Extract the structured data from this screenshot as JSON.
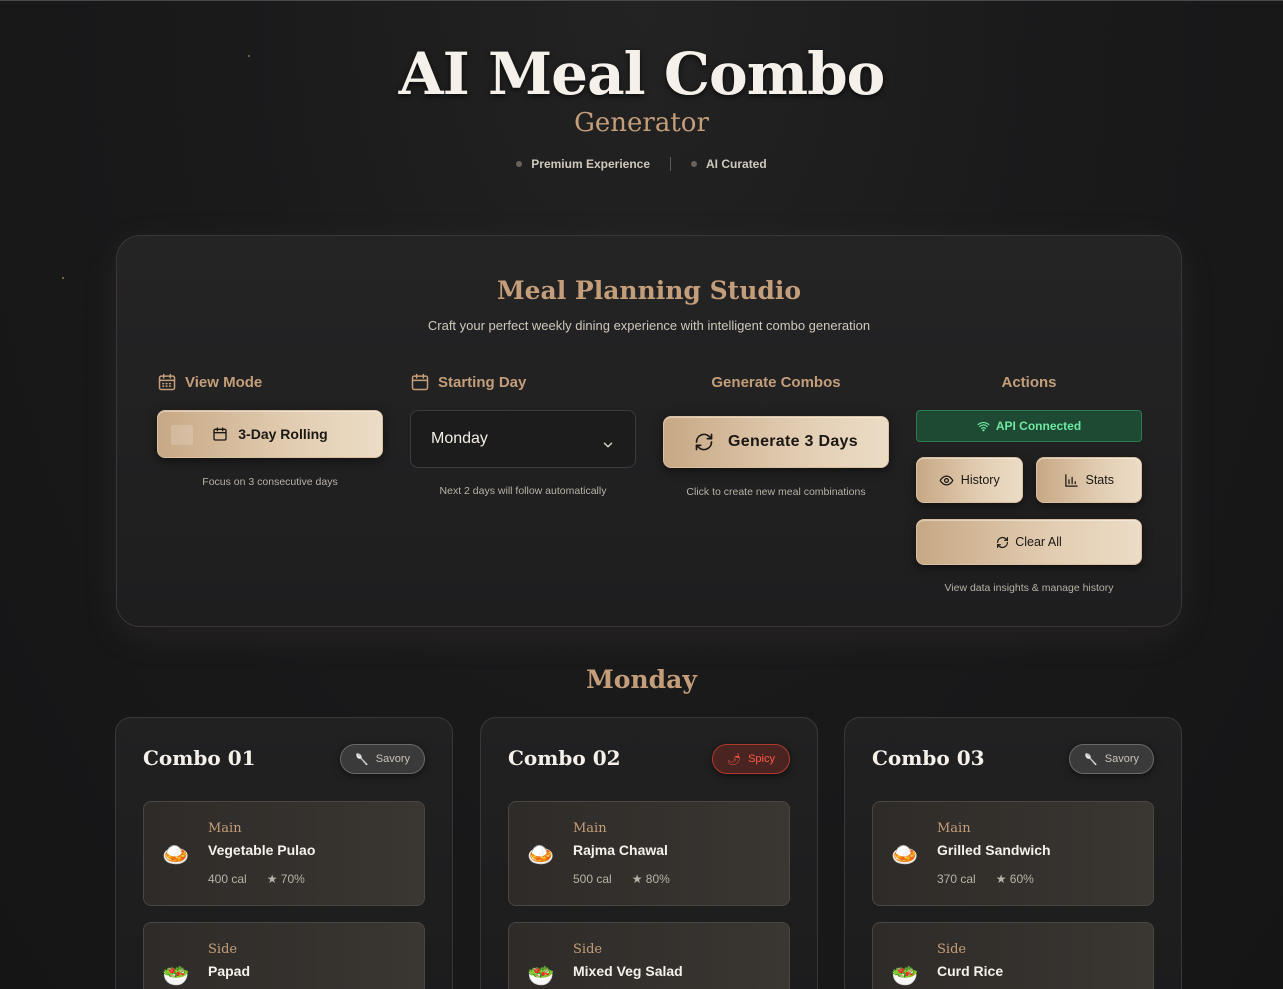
{
  "header": {
    "title": "AI Meal Combo",
    "subtitle": "Generator",
    "badges": [
      "Premium Experience",
      "AI Curated"
    ]
  },
  "studio": {
    "title": "Meal Planning Studio",
    "description": "Craft your perfect weekly dining experience with intelligent combo generation",
    "view_mode": {
      "label": "View Mode",
      "button": "3-Day Rolling",
      "hint": "Focus on 3 consecutive days"
    },
    "starting_day": {
      "label": "Starting Day",
      "value": "Monday",
      "hint": "Next 2 days will follow automatically"
    },
    "generate": {
      "label": "Generate Combos",
      "button": "Generate 3 Days",
      "hint": "Click to create new meal combinations"
    },
    "actions": {
      "label": "Actions",
      "status": "API Connected",
      "history": "History",
      "stats": "Stats",
      "clear": "Clear All",
      "hint": "View data insights & manage history"
    }
  },
  "day": "Monday",
  "combos": [
    {
      "title": "Combo 01",
      "tag": "Savory",
      "tag_icon": "🥄",
      "main": {
        "category": "Main",
        "name": "Vegetable Pulao",
        "cal": "400 cal",
        "rating": "★ 70%",
        "icon": "🍛"
      },
      "side": {
        "category": "Side",
        "name": "Papad",
        "icon": "🥗"
      }
    },
    {
      "title": "Combo 02",
      "tag": "Spicy",
      "tag_icon": "🌶",
      "main": {
        "category": "Main",
        "name": "Rajma Chawal",
        "cal": "500 cal",
        "rating": "★ 80%",
        "icon": "🍛"
      },
      "side": {
        "category": "Side",
        "name": "Mixed Veg Salad",
        "icon": "🥗"
      }
    },
    {
      "title": "Combo 03",
      "tag": "Savory",
      "tag_icon": "🥄",
      "main": {
        "category": "Main",
        "name": "Grilled Sandwich",
        "cal": "370 cal",
        "rating": "★ 60%",
        "icon": "🍛"
      },
      "side": {
        "category": "Side",
        "name": "Curd Rice",
        "icon": "🥗"
      }
    }
  ],
  "colors": {
    "accent": "#c49e7a",
    "background": "#1a1a1b",
    "gold_button": "#e2cdb2",
    "api_green": "#6ee7a3",
    "spicy_red": "#ff5a4a"
  }
}
